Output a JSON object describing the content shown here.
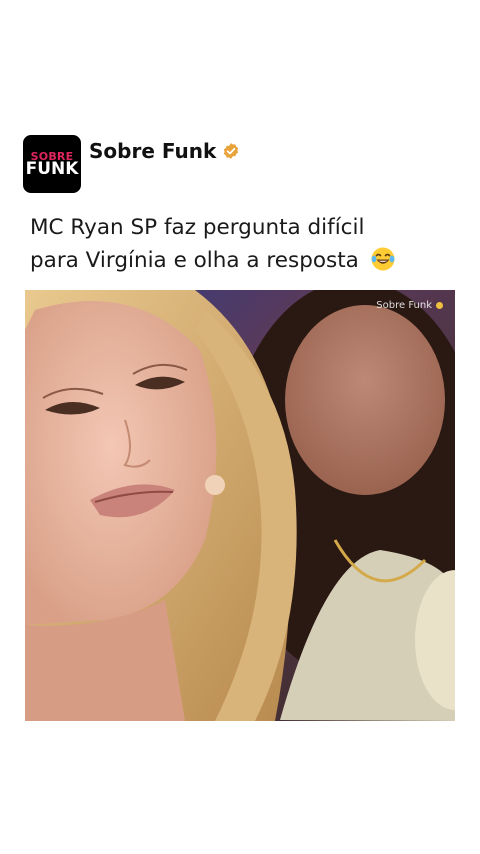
{
  "post": {
    "avatar_line1": "SOBRE",
    "avatar_line2": "FUNK",
    "account_name": "Sobre Funk",
    "caption_line1": "MC Ryan SP faz pergunta difícil",
    "caption_line2": "para Virgínia e olha a resposta",
    "watermark": "Sobre Funk"
  },
  "icons": {
    "verified": "verified-badge-icon",
    "emoji": "face-with-tears-of-joy-emoji"
  },
  "colors": {
    "brand_red": "#e0245e",
    "verified_gold": "#e8a33a"
  }
}
